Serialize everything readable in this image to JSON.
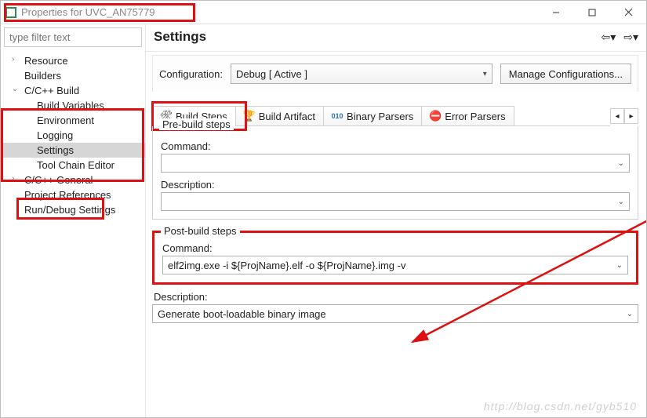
{
  "window": {
    "title": "Properties for UVC_AN75779"
  },
  "filter": {
    "placeholder": "type filter text"
  },
  "tree": {
    "resource": "Resource",
    "builders": "Builders",
    "ccbuild": "C/C++ Build",
    "buildvars": "Build Variables",
    "environment": "Environment",
    "logging": "Logging",
    "settings": "Settings",
    "toolchain": "Tool Chain Editor",
    "ccgeneral": "C/C++ General",
    "projectrefs": "Project References",
    "rundebug": "Run/Debug Settings"
  },
  "page": {
    "title": "Settings",
    "config_label": "Configuration:",
    "config_value": "Debug  [ Active ]",
    "manage_btn": "Manage Configurations..."
  },
  "tabs": {
    "buildsteps": "Build Steps",
    "buildartifact": "Build Artifact",
    "binaryparsers": "Binary Parsers",
    "errorparsers": "Error Parsers"
  },
  "pre": {
    "legend": "Pre-build steps",
    "command_label": "Command:",
    "command_value": "",
    "desc_label": "Description:",
    "desc_value": ""
  },
  "post": {
    "legend": "Post-build steps",
    "command_label": "Command:",
    "command_value": "elf2img.exe -i ${ProjName}.elf -o ${ProjName}.img -v",
    "desc_label": "Description:",
    "desc_value": "Generate boot-loadable binary image"
  },
  "watermark": "http://blog.csdn.net/gyb510"
}
